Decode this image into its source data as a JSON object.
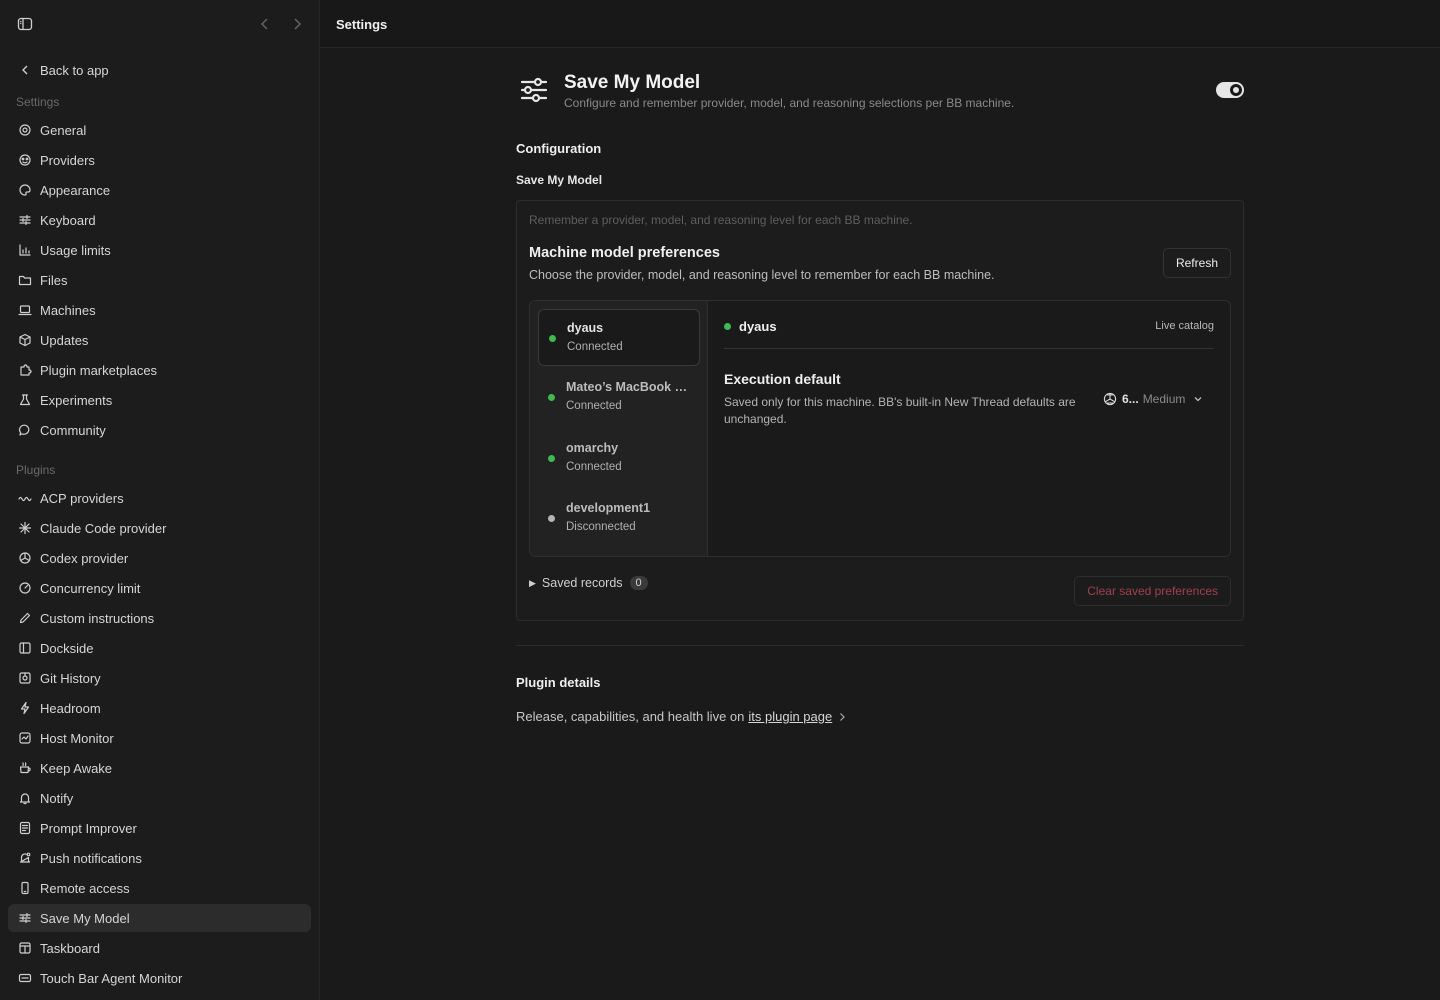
{
  "header": {
    "title": "Settings"
  },
  "sidebar": {
    "back_label": "Back to app",
    "settings_heading": "Settings",
    "settings_items": [
      {
        "label": "General",
        "icon": "gear-icon"
      },
      {
        "label": "Providers",
        "icon": "providers-icon"
      },
      {
        "label": "Appearance",
        "icon": "palette-icon"
      },
      {
        "label": "Keyboard",
        "icon": "sliders-icon"
      },
      {
        "label": "Usage limits",
        "icon": "chart-icon"
      },
      {
        "label": "Files",
        "icon": "folder-icon"
      },
      {
        "label": "Machines",
        "icon": "laptop-icon"
      },
      {
        "label": "Updates",
        "icon": "box-icon"
      },
      {
        "label": "Plugin marketplaces",
        "icon": "puzzle-icon"
      },
      {
        "label": "Experiments",
        "icon": "flask-icon"
      },
      {
        "label": "Community",
        "icon": "chat-icon"
      }
    ],
    "plugins_heading": "Plugins",
    "plugin_items": [
      {
        "label": "ACP providers",
        "icon": "acp-icon"
      },
      {
        "label": "Claude Code provider",
        "icon": "claude-icon"
      },
      {
        "label": "Codex provider",
        "icon": "openai-icon"
      },
      {
        "label": "Concurrency limit",
        "icon": "gauge-icon"
      },
      {
        "label": "Custom instructions",
        "icon": "pen-icon"
      },
      {
        "label": "Dockside",
        "icon": "panel-icon"
      },
      {
        "label": "Git History",
        "icon": "history-icon"
      },
      {
        "label": "Headroom",
        "icon": "bolt-icon"
      },
      {
        "label": "Host Monitor",
        "icon": "monitor-icon"
      },
      {
        "label": "Keep Awake",
        "icon": "coffee-icon"
      },
      {
        "label": "Notify",
        "icon": "bell-icon"
      },
      {
        "label": "Prompt Improver",
        "icon": "document-icon"
      },
      {
        "label": "Push notifications",
        "icon": "bell-dot-icon"
      },
      {
        "label": "Remote access",
        "icon": "phone-icon"
      },
      {
        "label": "Save My Model",
        "icon": "sliders-icon",
        "active": true
      },
      {
        "label": "Taskboard",
        "icon": "board-icon"
      },
      {
        "label": "Touch Bar Agent Monitor",
        "icon": "touchbar-icon"
      }
    ]
  },
  "plugin": {
    "title": "Save My Model",
    "subtitle": "Configure and remember provider, model, and reasoning selections per BB machine.",
    "enabled": true
  },
  "configuration": {
    "heading": "Configuration",
    "subheading": "Save My Model",
    "hint": "Remember a provider, model, and reasoning level for each BB machine.",
    "title": "Machine model preferences",
    "description": "Choose the provider, model, and reasoning level to remember for each BB machine.",
    "refresh_label": "Refresh",
    "machines": [
      {
        "name": "dyaus",
        "status": "Connected",
        "selected": true,
        "color": "#3fb950"
      },
      {
        "name": "Mateo’s MacBook Pro",
        "status": "Connected",
        "selected": false,
        "color": "#3fb950"
      },
      {
        "name": "omarchy",
        "status": "Connected",
        "selected": false,
        "color": "#3fb950"
      },
      {
        "name": "development1",
        "status": "Disconnected",
        "selected": false,
        "color": "#b5b5b5"
      }
    ],
    "detail": {
      "machine_name": "dyaus",
      "catalog_label": "Live catalog",
      "execution_title": "Execution default",
      "execution_desc": "Saved only for this machine. BB's built-in New Thread defaults are unchanged.",
      "model_label": "6...",
      "reasoning_label": "Medium"
    },
    "saved_records_label": "Saved records",
    "saved_records_count": "0",
    "clear_label": "Clear saved preferences"
  },
  "plugin_details": {
    "heading": "Plugin details",
    "text": "Release, capabilities, and health live on",
    "link": "its plugin page"
  },
  "colors": {
    "accent_green": "#3fb950",
    "danger": "#a0404c"
  }
}
